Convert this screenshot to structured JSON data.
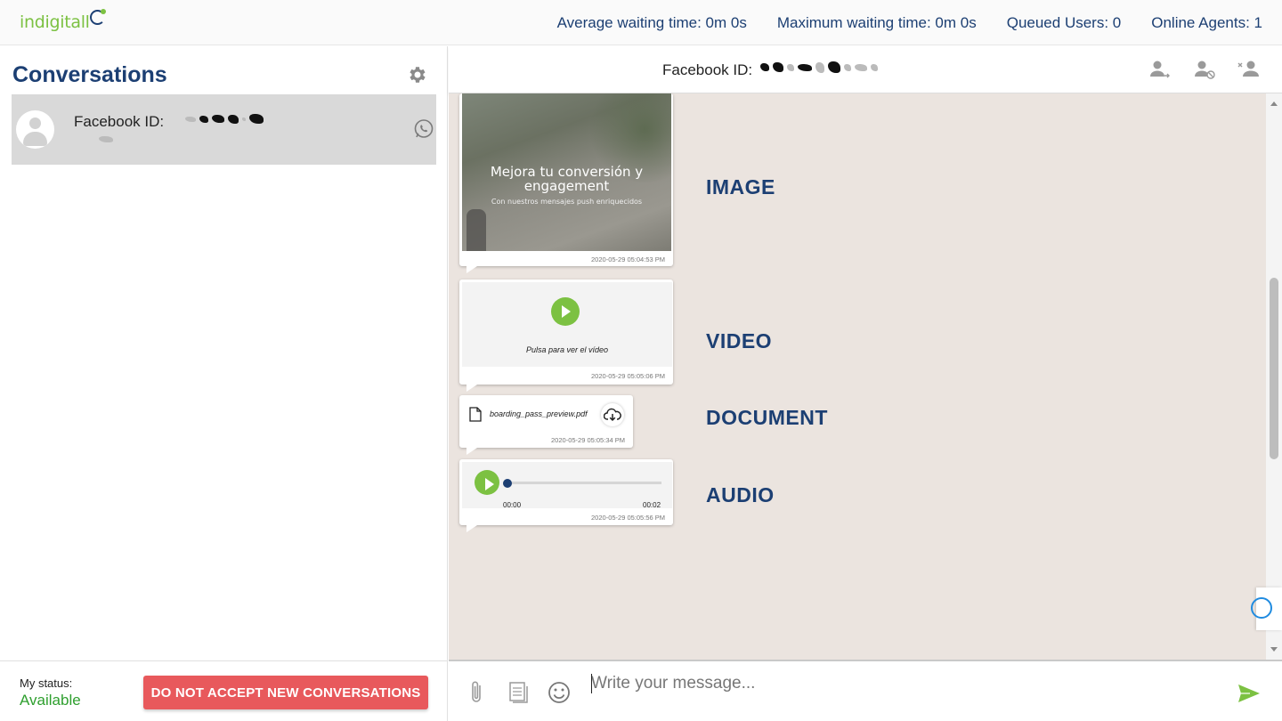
{
  "brand": {
    "logo_text": "indigitall"
  },
  "header": {
    "stats": [
      {
        "label": "Average waiting time: 0m 0s"
      },
      {
        "label": "Maximum waiting time: 0m 0s"
      },
      {
        "label": "Queued Users: 0"
      },
      {
        "label": "Online Agents: 1"
      }
    ]
  },
  "sidebar": {
    "title": "Conversations",
    "settings_icon": "gear-icon",
    "conversation": {
      "label": "Facebook ID:",
      "channel_icon": "whatsapp-icon"
    }
  },
  "status": {
    "label": "My status:",
    "value": "Available",
    "button_label": "DO NOT ACCEPT NEW CONVERSATIONS",
    "button_color": "#e8595c",
    "value_color": "#2e9f2e"
  },
  "chat": {
    "title": "Facebook ID:",
    "header_icons": [
      "transfer-user-icon",
      "block-user-icon",
      "close-user-icon"
    ],
    "messages": [
      {
        "type_label": "IMAGE",
        "image_title": "Mejora tu conversión y engagement",
        "image_subtitle": "Con nuestros mensajes push enriquecidos",
        "timestamp": "2020-05-29 05:04:53 PM"
      },
      {
        "type_label": "VIDEO",
        "caption": "Pulsa para ver el vídeo",
        "timestamp": "2020-05-29 05:05:06 PM"
      },
      {
        "type_label": "DOCUMENT",
        "file_name": "boarding_pass_preview.pdf",
        "timestamp": "2020-05-29 05:05:34 PM"
      },
      {
        "type_label": "AUDIO",
        "time_start": "00:00",
        "time_end": "00:02",
        "progress": 0,
        "timestamp": "2020-05-29 05:05:56 PM"
      }
    ],
    "background_color": "#ebe4df",
    "accent_color": "#1c3f73",
    "play_color": "#7cc142"
  },
  "composer": {
    "placeholder": "Write your message...",
    "icons": [
      "attachment-icon",
      "templates-icon",
      "emoji-icon",
      "send-icon"
    ]
  }
}
